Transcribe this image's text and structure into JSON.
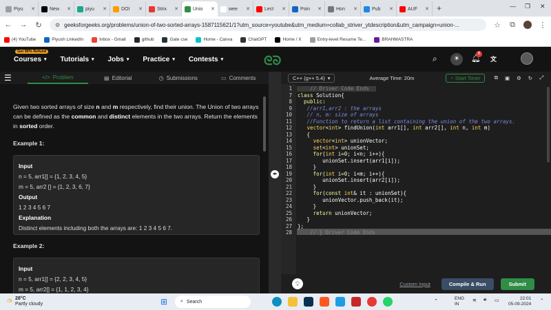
{
  "browser": {
    "tabs": [
      {
        "label": "Piyu",
        "color": "#9e9e9e"
      },
      {
        "label": "New",
        "color": "#000000"
      },
      {
        "label": "piyu",
        "color": "#1ea68d"
      },
      {
        "label": "DOI",
        "color": "#ff9d00"
      },
      {
        "label": "Strix",
        "color": "#e53935"
      },
      {
        "label": "Unio",
        "color": "#2f8d46",
        "active": true
      },
      {
        "label": "wee",
        "color": "#ffffff"
      },
      {
        "label": "Lect",
        "color": "#ff0000"
      },
      {
        "label": "Poin",
        "color": "#1565c0"
      },
      {
        "label": "Hon",
        "color": "#777777"
      },
      {
        "label": "Pub",
        "color": "#1e88e5"
      },
      {
        "label": "AUF",
        "color": "#ff0000"
      }
    ],
    "url": "geeksforgeeks.org/problems/union-of-two-sorted-arrays-1587115621/1?utm_source=youtube&utm_medium=collab_striver_ytdescription&utm_campaign=union-...",
    "bookmarks": [
      {
        "label": "(4) YouTube",
        "color": "#ff0000"
      },
      {
        "label": "Piyush LinkedIn",
        "color": "#0a66c2"
      },
      {
        "label": "Inbox - Gmail",
        "color": "#ea4335"
      },
      {
        "label": "github",
        "color": "#24292f"
      },
      {
        "label": "Gate cse",
        "color": "#263238"
      },
      {
        "label": "Home - Canva",
        "color": "#00c4cc"
      },
      {
        "label": "ChatGPT",
        "color": "#333333"
      },
      {
        "label": "Home / X",
        "color": "#000000"
      },
      {
        "label": "Entry-level Resume Te...",
        "color": "#9e9e9e"
      },
      {
        "label": "BRAHMASTRA",
        "color": "#6a1b9a"
      }
    ]
  },
  "header": {
    "badge": "Get 90% Refund",
    "menu": [
      "Courses",
      "Tutorials",
      "Jobs",
      "Practice",
      "Contests"
    ],
    "notif_count": "6"
  },
  "left_tabs": [
    {
      "label": "Problem",
      "icon": "code-icon"
    },
    {
      "label": "Editorial",
      "icon": "book-icon"
    },
    {
      "label": "Submissions",
      "icon": "clock-icon"
    },
    {
      "label": "Comments",
      "icon": "comment-icon"
    }
  ],
  "problem": {
    "p1": "Given two sorted arrays of size ",
    "n": "n",
    "p2": " and ",
    "m": "m",
    "p3": " respectively, find their union. The Union of two arrays can be defined as the ",
    "common": "common",
    "p4": " and ",
    "distinct": "distinct",
    "p5": " elements in the two arrays. Return the elements in ",
    "sorted": "sorted",
    "p6": " order."
  },
  "example1": {
    "title": "Example 1:",
    "input_label": "Input",
    "line1": "n = 5, arr1[] = {1, 2, 3, 4, 5}",
    "line2": "m = 5, arr2 [] = {1, 2, 3, 6, 7}",
    "output_label": "Output",
    "output": "1 2 3 4 5 6 7",
    "expl_label": "Explanation",
    "expl": "Distinct elements including both the arrays are: 1 2 3 4 5 6 7."
  },
  "example2": {
    "title": "Example 2:",
    "input_label": "Input",
    "line1": "n = 5, arr1[] = {2, 2, 3, 4, 5}",
    "line2": "m = 5, arr2[] = {1, 1, 2, 3, 4}"
  },
  "editor": {
    "language": "C++ (g++ 5.4)",
    "avg_time": "Average Time: 20m",
    "timer": "Start Timer",
    "line_numbers": [
      "1",
      "7",
      "8",
      "9",
      "10",
      "11",
      "12",
      "13",
      "14",
      "15",
      "16",
      "17",
      "18",
      "19",
      "20",
      "21",
      "22",
      "23",
      "24",
      "25",
      "26",
      "27",
      "28"
    ],
    "custom_input": "Custom Input",
    "compile": "Compile & Run",
    "submit": "Submit"
  },
  "taskbar": {
    "temp": "28°C",
    "weather": "Partly cloudy",
    "search": "Search",
    "lang1": "ENG",
    "lang2": "IN",
    "time": "22:01",
    "date": "05-09-2024"
  }
}
